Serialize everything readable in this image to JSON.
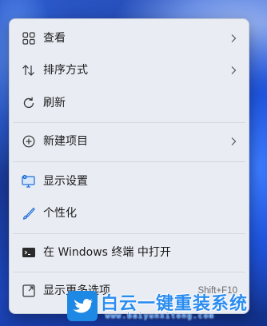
{
  "context_menu": {
    "items": [
      {
        "label": "查看",
        "icon": "grid-icon",
        "has_submenu": true
      },
      {
        "label": "排序方式",
        "icon": "sort-icon",
        "has_submenu": true
      },
      {
        "label": "刷新",
        "icon": "refresh-icon",
        "has_submenu": false
      },
      {
        "label": "新建项目",
        "icon": "new-item-icon",
        "has_submenu": true
      },
      {
        "label": "显示设置",
        "icon": "display-icon",
        "has_submenu": false
      },
      {
        "label": "个性化",
        "icon": "brush-icon",
        "has_submenu": false
      },
      {
        "label": "在 Windows 终端 中打开",
        "icon": "terminal-icon",
        "has_submenu": false
      },
      {
        "label": "显示更多选项",
        "icon": "more-options-icon",
        "has_submenu": false,
        "shortcut": "Shift+F10"
      }
    ]
  },
  "watermark": {
    "title": "白云一键重装系统",
    "url": "www.baiyunxitong.com"
  },
  "colors": {
    "menu_bg": "#e9ecf3",
    "accent": "#1e6fd9",
    "watermark": "#2b8df0"
  }
}
